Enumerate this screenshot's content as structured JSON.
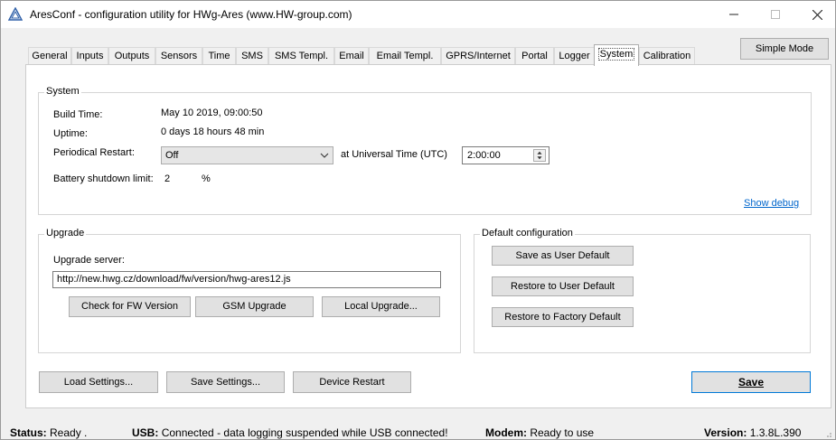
{
  "window": {
    "title": "AresConf - configuration utility for HWg-Ares (www.HW-group.com)",
    "icon": "ares-logo-icon"
  },
  "tabs": [
    {
      "label": "General"
    },
    {
      "label": "Inputs"
    },
    {
      "label": "Outputs"
    },
    {
      "label": "Sensors"
    },
    {
      "label": "Time"
    },
    {
      "label": "SMS"
    },
    {
      "label": "SMS Templ."
    },
    {
      "label": "Email"
    },
    {
      "label": "Email Templ."
    },
    {
      "label": "GPRS/Internet"
    },
    {
      "label": "Portal"
    },
    {
      "label": "Logger"
    },
    {
      "label": "System",
      "active": true
    },
    {
      "label": "Calibration"
    }
  ],
  "simple_mode_label": "Simple Mode",
  "system": {
    "title": "System",
    "build_time_label": "Build Time:",
    "build_time_value": "May 10 2019, 09:00:50",
    "uptime_label": "Uptime:",
    "uptime_value": "0 days 18 hours 48 min",
    "restart_label": "Periodical Restart:",
    "restart_value": "Off",
    "utc_label": "at Universal Time (UTC)",
    "utc_value": "2:00:00",
    "battery_label": "Battery shutdown limit:",
    "battery_value": "2",
    "battery_unit": "%",
    "show_debug": "Show debug"
  },
  "upgrade": {
    "title": "Upgrade",
    "server_label": "Upgrade server:",
    "server_value": "http://new.hwg.cz/download/fw/version/hwg-ares12.js",
    "check_label": "Check for FW Version",
    "gsm_label": "GSM Upgrade",
    "local_label": "Local Upgrade..."
  },
  "default_config": {
    "title": "Default configuration",
    "save_user_label": "Save as User Default",
    "restore_user_label": "Restore to User Default",
    "restore_factory_label": "Restore to Factory Default"
  },
  "bottom": {
    "load_label": "Load Settings...",
    "save_settings_label": "Save Settings...",
    "restart_label": "Device Restart",
    "save_label": "Save"
  },
  "status": {
    "status_key": "Status:",
    "status_value": "Ready .",
    "usb_key": "USB:",
    "usb_value": "Connected - data logging suspended while USB connected!",
    "modem_key": "Modem:",
    "modem_value": "Ready to use",
    "version_key": "Version:",
    "version_value": "1.3.8L.390"
  }
}
